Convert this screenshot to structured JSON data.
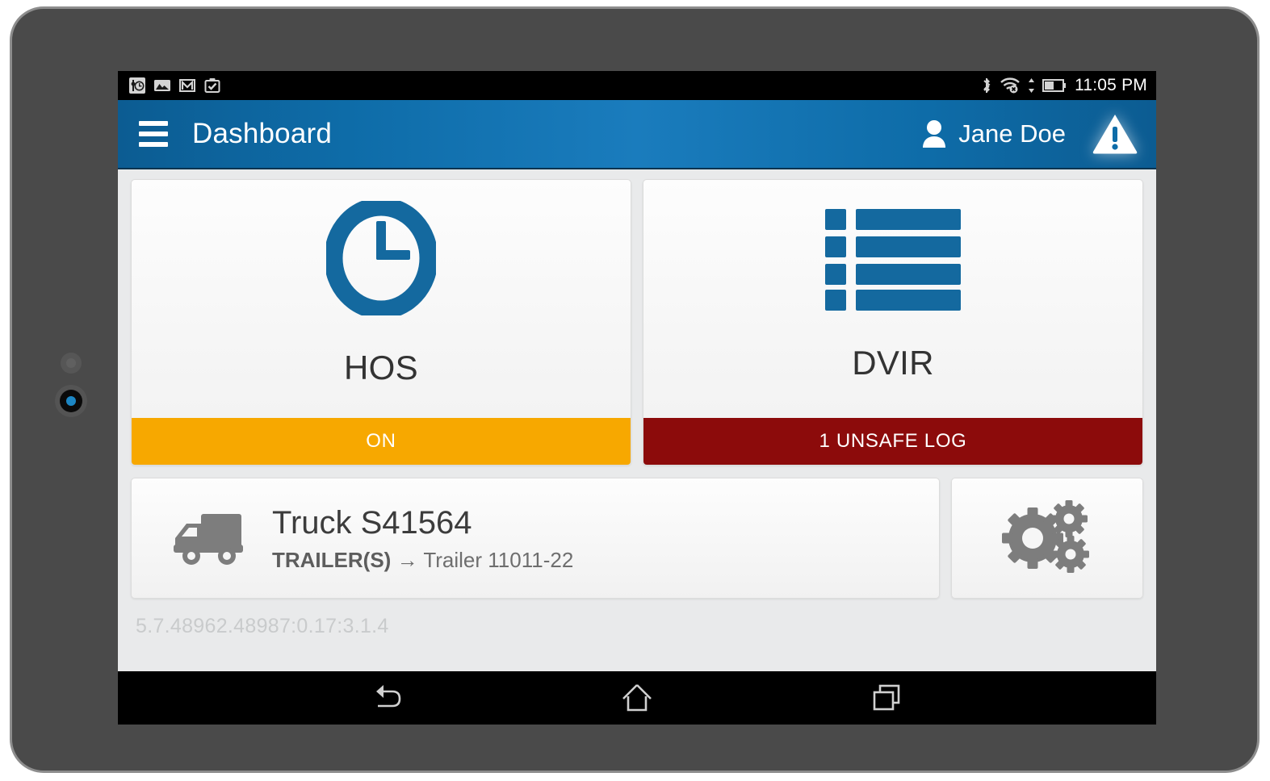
{
  "device": {
    "sensor_icon": "ambient-light-sensor",
    "camera_icon": "front-camera"
  },
  "status_bar": {
    "notifications": [
      {
        "name": "settings-clock-icon"
      },
      {
        "name": "photo-image-icon"
      },
      {
        "name": "gmail-icon"
      },
      {
        "name": "clipboard-check-icon"
      }
    ],
    "indicators": [
      {
        "name": "bluetooth-icon"
      },
      {
        "name": "wifi-disconnected-icon"
      },
      {
        "name": "data-transfer-arrows-icon"
      },
      {
        "name": "battery-icon"
      }
    ],
    "time": "11:05 PM"
  },
  "header": {
    "menu_icon": "hamburger-menu-icon",
    "title": "Dashboard",
    "user_icon": "person-avatar-icon",
    "user_name": "Jane Doe",
    "alert_icon": "warning-triangle-icon",
    "accent_color": "#1a7cbd"
  },
  "tiles": [
    {
      "key": "hos",
      "icon": "clock-icon",
      "label": "HOS",
      "status": "ON",
      "status_color": "#f7a800"
    },
    {
      "key": "dvir",
      "icon": "list-icon",
      "label": "DVIR",
      "status": "1 UNSAFE LOG",
      "status_color": "#8c0b0b"
    }
  ],
  "vehicle": {
    "icon": "truck-icon",
    "name": "Truck S41564",
    "trailer_label": "TRAILER(S)",
    "trailer_arrow": "→",
    "trailer_value": "Trailer 11011-22"
  },
  "settings": {
    "icon": "gears-icon"
  },
  "footer": {
    "version": "5.7.48962.48987:0.17:3.1.4"
  },
  "nav_bar": {
    "buttons": [
      {
        "name": "back-button"
      },
      {
        "name": "home-button"
      },
      {
        "name": "recent-apps-button"
      }
    ]
  }
}
